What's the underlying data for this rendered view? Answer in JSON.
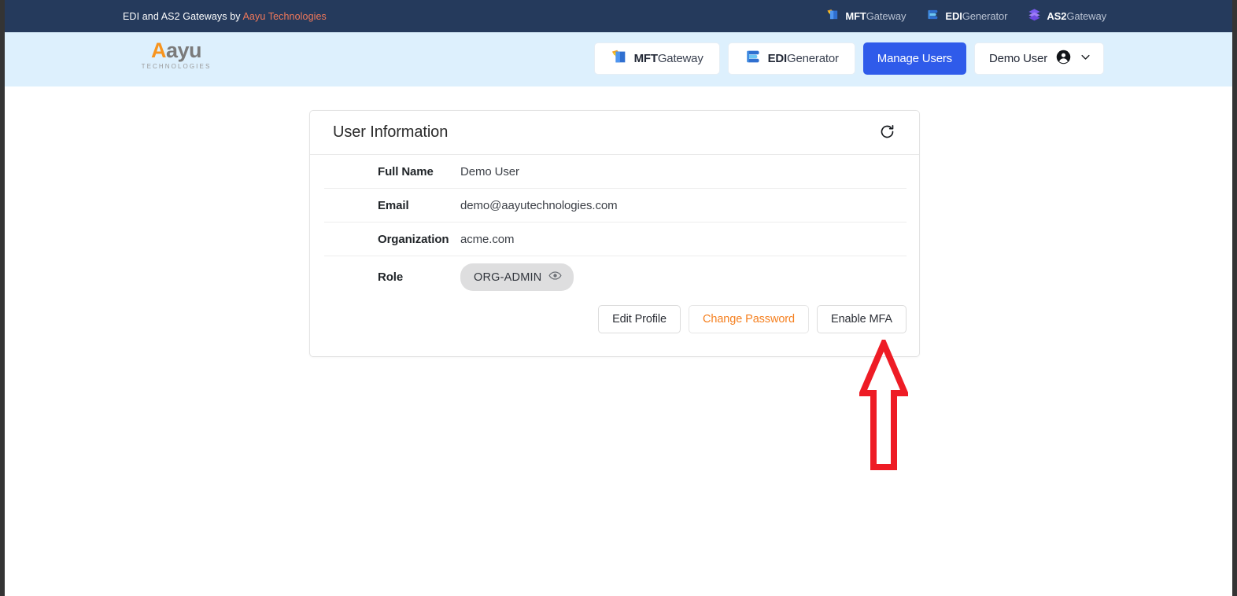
{
  "topbar": {
    "tagline_prefix": "EDI and AS2 Gateways by ",
    "tagline_brand": "Aayu Technologies",
    "products": [
      {
        "name_bold": "MFT",
        "name_thin": "Gateway",
        "icon": "mftgateway-icon"
      },
      {
        "name_bold": "EDI",
        "name_thin": "Generator",
        "icon": "edigenerator-icon"
      },
      {
        "name_bold": "AS2",
        "name_thin": "Gateway",
        "icon": "as2gateway-icon"
      }
    ]
  },
  "header": {
    "logo_word_mark": "A",
    "logo_word_rest": "ayu",
    "logo_sub": "TECHNOLOGIES",
    "nav": [
      {
        "bold": "MFT",
        "thin": "Gateway",
        "kind": "product",
        "icon": "mftgateway-icon"
      },
      {
        "bold": "EDI",
        "thin": "Generator",
        "kind": "product",
        "icon": "edigenerator-icon"
      },
      {
        "label": "Manage Users",
        "kind": "primary"
      },
      {
        "label": "Demo User",
        "kind": "user",
        "icon": "account-circle-icon",
        "caret": "chevron-down-icon"
      }
    ]
  },
  "card": {
    "title": "User Information",
    "refresh_icon": "refresh-icon",
    "rows": [
      {
        "label": "Full Name",
        "value": "Demo User"
      },
      {
        "label": "Email",
        "value": "demo@aayutechnologies.com"
      },
      {
        "label": "Organization",
        "value": "acme.com"
      }
    ],
    "role": {
      "label": "Role",
      "badge_text": "ORG-ADMIN",
      "badge_icon": "eye-icon"
    },
    "actions": [
      {
        "label": "Edit Profile",
        "style": "default"
      },
      {
        "label": "Change Password",
        "style": "accent"
      },
      {
        "label": "Enable MFA",
        "style": "default"
      }
    ]
  },
  "annotation": {
    "type": "arrow-up",
    "color": "#ee1c25",
    "points_at": "Enable MFA"
  },
  "colors": {
    "topbar_bg": "#253a5c",
    "header_bg": "#ddf0fd",
    "brand_orange": "#f7941e",
    "link_orange": "#f0785a",
    "primary_blue": "#2f5bea",
    "annotation_red": "#ee1c25",
    "badge_gray": "#dededf"
  }
}
